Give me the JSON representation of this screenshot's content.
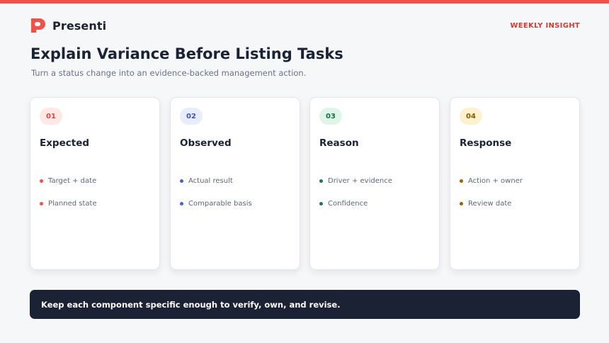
{
  "brand": {
    "name": "Presenti",
    "logo_icon": "presenti-p-logo-icon",
    "accent": "#f0524a"
  },
  "header": {
    "section_tag": "WEEKLY INSIGHT"
  },
  "title": "Explain Variance Before Listing Tasks",
  "subtitle": "Turn a status change into an evidence-backed management action.",
  "cards": [
    {
      "number": "01",
      "title": "Expected",
      "badge_bg": "#fde8e6",
      "badge_fg": "#e0473f",
      "dot_color": "#f0524a",
      "bullets": [
        "Target + date",
        "Planned state"
      ]
    },
    {
      "number": "02",
      "title": "Observed",
      "badge_bg": "#e8ecfb",
      "badge_fg": "#3e54c7",
      "dot_color": "#4a5fd0",
      "bullets": [
        "Actual result",
        "Comparable basis"
      ]
    },
    {
      "number": "03",
      "title": "Reason",
      "badge_bg": "#dff5ea",
      "badge_fg": "#14724a",
      "dot_color": "#1a7a50",
      "bullets": [
        "Driver + evidence",
        "Confidence"
      ]
    },
    {
      "number": "04",
      "title": "Response",
      "badge_bg": "#fdf1cf",
      "badge_fg": "#8a5a00",
      "dot_color": "#9a6400",
      "bullets": [
        "Action + owner",
        "Review date"
      ]
    }
  ],
  "banner": {
    "text": "Keep each component specific enough to verify, own, and revise."
  }
}
